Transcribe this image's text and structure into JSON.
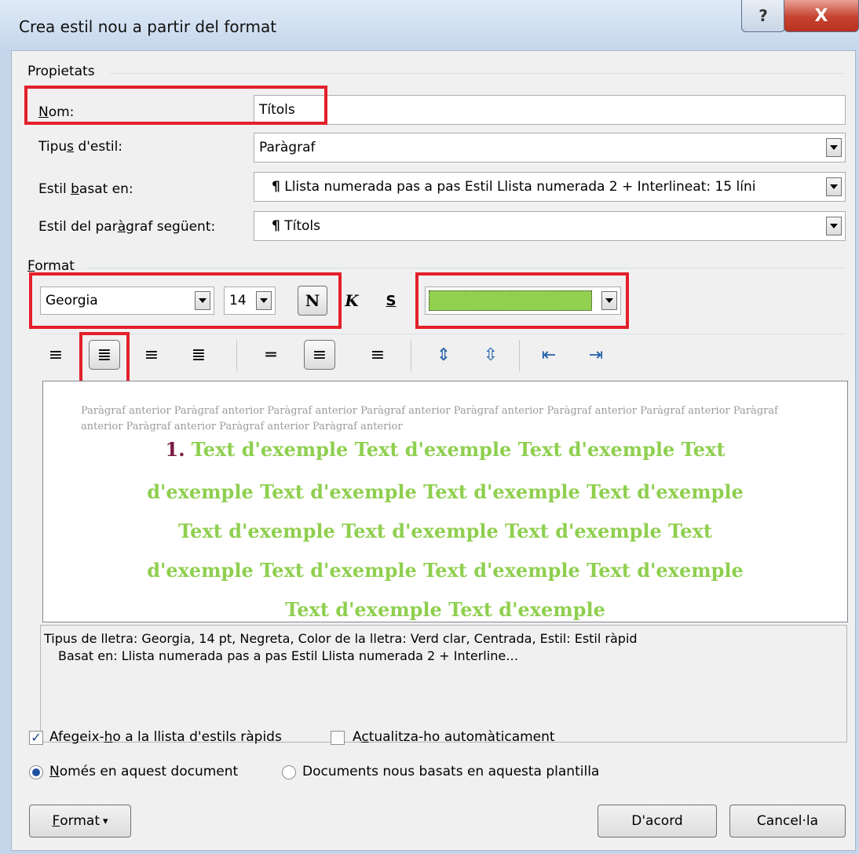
{
  "window": {
    "title": "Crea estil nou a partir del format",
    "help_label": "?",
    "close_label": "X"
  },
  "properties": {
    "section_label": "Propietats",
    "name_label_pre": "",
    "name_label_u": "N",
    "name_label_post": "om:",
    "name_value": "Títols",
    "style_type_label_pre": "Tipu",
    "style_type_label_u": "s",
    "style_type_label_post": " d'estil:",
    "style_type_value": "Paràgraf",
    "based_on_label_pre": "Estil ",
    "based_on_label_u": "b",
    "based_on_label_post": "asat en:",
    "based_on_value": "Llista numerada pas a pas Estil Llista numerada 2 + Interlineat:  15 líni",
    "next_label_pre": "Estil del par",
    "next_label_u": "à",
    "next_label_post": "graf següent:",
    "next_value": "Títols",
    "pilcrow": "¶"
  },
  "format": {
    "section_label_pre": "",
    "section_label_u": "F",
    "section_label_post": "ormat",
    "font": "Georgia",
    "size": "14",
    "bold": "N",
    "italic": "K",
    "underline": "S",
    "color": "#92d050"
  },
  "preview": {
    "prior_text": "Paràgraf anterior Paràgraf anterior Paràgraf anterior Paràgraf anterior Paràgraf anterior Paràgraf anterior Paràgraf anterior Paràgraf anterior Paràgraf anterior Paràgraf anterior Paràgraf anterior",
    "number": "1.",
    "lines": [
      "Text d'exemple Text d'exemple Text d'exemple Text",
      "d'exemple Text d'exemple Text d'exemple Text d'exemple",
      "Text d'exemple Text d'exemple Text d'exemple Text",
      "d'exemple Text d'exemple Text d'exemple Text d'exemple",
      "Text d'exemple Text d'exemple"
    ]
  },
  "description": {
    "line1": "Tipus de lletra: Georgia, 14 pt, Negreta, Color de la lletra: Verd clar, Centrada, Estil: Estil ràpid",
    "line2": "Basat en: Llista numerada pas a pas Estil Llista numerada 2 + Interline…"
  },
  "options": {
    "quick_list_pre": "Afegeix-",
    "quick_list_u": "h",
    "quick_list_post": "o a la llista d'estils ràpids",
    "quick_list_checked": "✓",
    "auto_update_pre": "A",
    "auto_update_u": "c",
    "auto_update_post": "tualitza-ho automàticament",
    "only_doc_pre": "",
    "only_doc_u": "N",
    "only_doc_post": "omés en aquest document",
    "new_docs": "Documents nous basats en aquesta plantilla"
  },
  "buttons": {
    "format_pre": "",
    "format_u": "F",
    "format_post": "ormat",
    "format_arrow": "▾",
    "ok": "D'acord",
    "cancel": "Cancel·la"
  }
}
